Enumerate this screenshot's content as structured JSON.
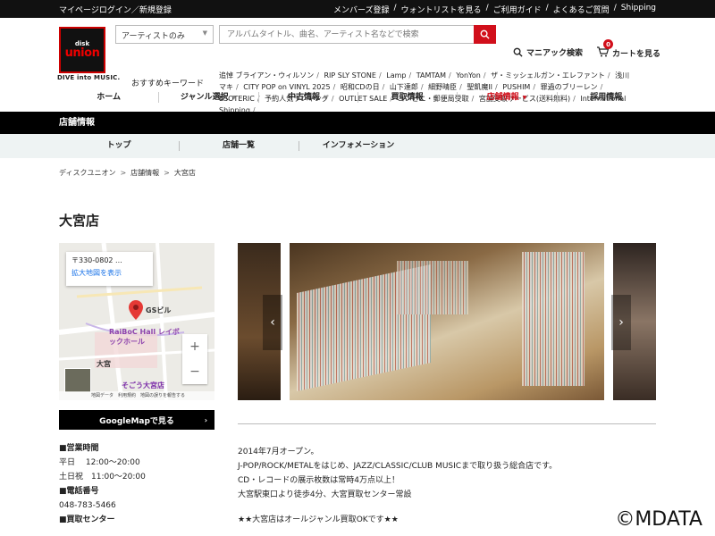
{
  "topbar": {
    "left": "マイページログイン／新規登録",
    "right": [
      "メンバーズ登録",
      "ウォントリストを見る",
      "ご利用ガイド",
      "よくあるご質問",
      "Shipping"
    ]
  },
  "logo": {
    "disk": "disk",
    "union": "union",
    "tagline": "DIVE into MUSIC."
  },
  "search": {
    "scope": "アーティストのみ",
    "placeholder": "アルバムタイトル、曲名、アーティスト名などで検索"
  },
  "maniac_label": "マニアック検索",
  "cart": {
    "label": "カートを見る",
    "count": "0"
  },
  "keywords": {
    "label": "おすすめキーワード",
    "items": [
      "追悼 ブライアン・ウィルソン",
      "RIP SLY STONE",
      "Lamp",
      "TAMTAM",
      "YonYon",
      "ザ・ミッシェルガン・エレファント",
      "浅川マキ",
      "CITY POP on VINYL 2025",
      "昭和CDの日",
      "山下達郎",
      "細野晴臣",
      "聖飢魔II",
      "PUSHIM",
      "罪過のブリーレン",
      "ESOTERIC",
      "予約人気ランキング",
      "OUTLET SALE",
      "コンビニ・郵便局受取",
      "宮舗受取サービス(送料無料)",
      "International Shipping"
    ]
  },
  "mainnav": [
    {
      "label": "ホーム",
      "dropdown": false,
      "active": false
    },
    {
      "label": "ジャンル選択",
      "dropdown": true,
      "active": false
    },
    {
      "label": "中古情報",
      "dropdown": true,
      "active": false
    },
    {
      "label": "買取情報",
      "dropdown": false,
      "active": false
    },
    {
      "label": "店舗情報",
      "dropdown": true,
      "active": true
    },
    {
      "label": "採用情報",
      "dropdown": false,
      "active": false
    }
  ],
  "band_title": "店舗情報",
  "subnav": [
    "トップ",
    "店舗一覧",
    "インフォメーション"
  ],
  "breadcrumb": [
    "ディスクユニオン",
    "店舗情報",
    "大宮店"
  ],
  "page_title": "大宮店",
  "map": {
    "zip": "〒330-0802 ...",
    "enlarge": "拡大地図を表示",
    "pin_label": "GSビル",
    "hall_label": "RaiBoC Hall レイボックホール",
    "station_label": "大宮",
    "sogo_label": "そごう大宮店",
    "footer": "地図データ　利用規約　地図の誤りを報告する"
  },
  "gmap_button": "GoogleMapで見る",
  "info": {
    "hours_heading": "■営業時間",
    "hours": [
      "平日　 12:00〜20:00",
      "土日祝　11:00〜20:00"
    ],
    "phone_heading": "■電話番号",
    "phone": "048-783-5466",
    "buy_heading": "■買取センター"
  },
  "description": {
    "lines": [
      "2014年7月オープン。",
      "J-POP/ROCK/METALをはじめ、JAZZ/CLASSIC/CLUB MUSICまで取り扱う総合店です。",
      "CD・レコードの展示枚数は常時4万点以上！",
      "大宮駅東口より徒歩4分、大宮買取センター常設"
    ],
    "note": "★★大宮店はオールジャンル買取OKです★★"
  },
  "watermark": "©MDATA"
}
